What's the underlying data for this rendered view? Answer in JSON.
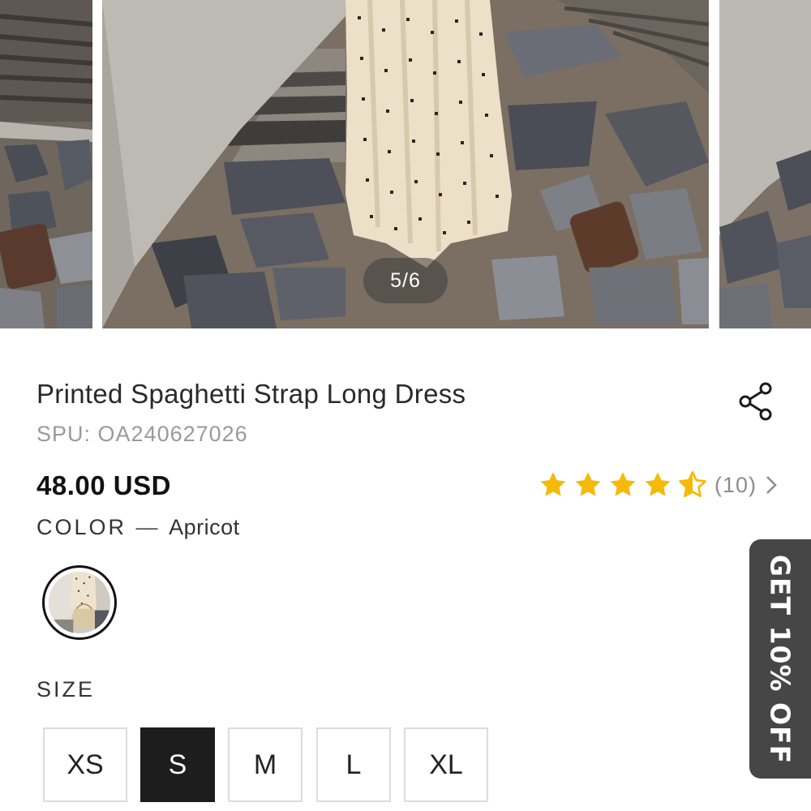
{
  "gallery": {
    "counter": "5/6",
    "current_index": 5,
    "total": 6
  },
  "product": {
    "title": "Printed Spaghetti Strap Long Dress",
    "spu_label": "SPU:",
    "spu_value": "OA240627026",
    "price": "48.00 USD",
    "rating": {
      "stars": 4.5,
      "out_of": 5,
      "count_text": "(10)",
      "star_color": "#f5b90a"
    },
    "color": {
      "label": "COLOR",
      "separator": "—",
      "value": "Apricot"
    },
    "size": {
      "label": "SIZE",
      "options": [
        "XS",
        "S",
        "M",
        "L",
        "XL"
      ],
      "selected": "S"
    }
  },
  "icons": {
    "share": "share-icon",
    "chevron": "chevron-right-icon",
    "star": "star-icon"
  },
  "promo": {
    "text": "GET 10% OFF",
    "background": "#464646"
  }
}
